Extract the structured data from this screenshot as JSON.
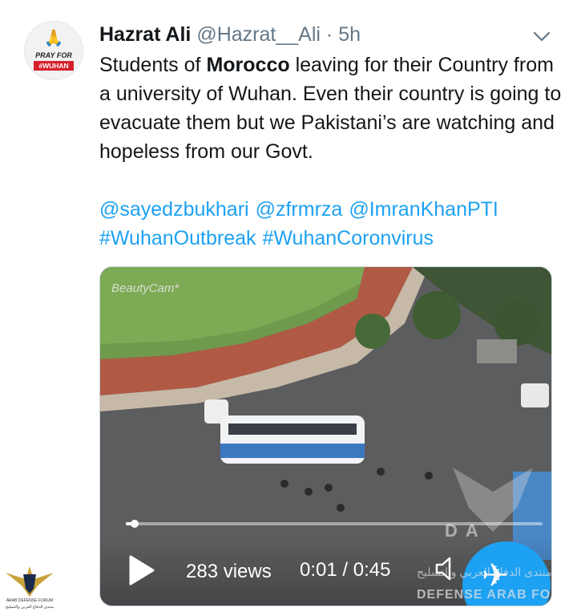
{
  "author": {
    "name": "Hazrat Ali",
    "handle": "@Hazrat__Ali",
    "separator": "·",
    "time": "5h",
    "avatar": {
      "line1": "PRAY FOR",
      "line2": "#WUHAN",
      "icon": "praying-hands-icon"
    }
  },
  "tweet": {
    "text_before": "Students of ",
    "text_bold": "Morocco",
    "text_after": " leaving for their Country from a university of Wuhan. Even their country is going to evacuate them but we Pakistani’s are watching and hopeless from our Govt.",
    "mentions": [
      "@sayedzbukhari",
      "@zfrmrza",
      "@ImranKhanPTI"
    ],
    "hashtags": [
      "#WuhanOutbreak",
      "#WuhanCoronvirus"
    ]
  },
  "video": {
    "watermark": "BeautyCam*",
    "views": "283 views",
    "current_time": "0:01",
    "duration": "0:45",
    "time_separator": " / ",
    "progress_fraction": 0.022,
    "overlay_logo_text": "DA",
    "overlay_arabic": "منتدى الدفاع العربي والتسليح",
    "overlay_forum": "DEFENSE ARAB FOR"
  },
  "forum_logo": {
    "line1": "ARAB DEFENSE FORUM",
    "line2": "منتدى الدفاع العربي والتسليح"
  },
  "colors": {
    "link": "#1da1f2",
    "text": "#14171a",
    "muted": "#657786",
    "accent_badge": "#1da1f2"
  }
}
